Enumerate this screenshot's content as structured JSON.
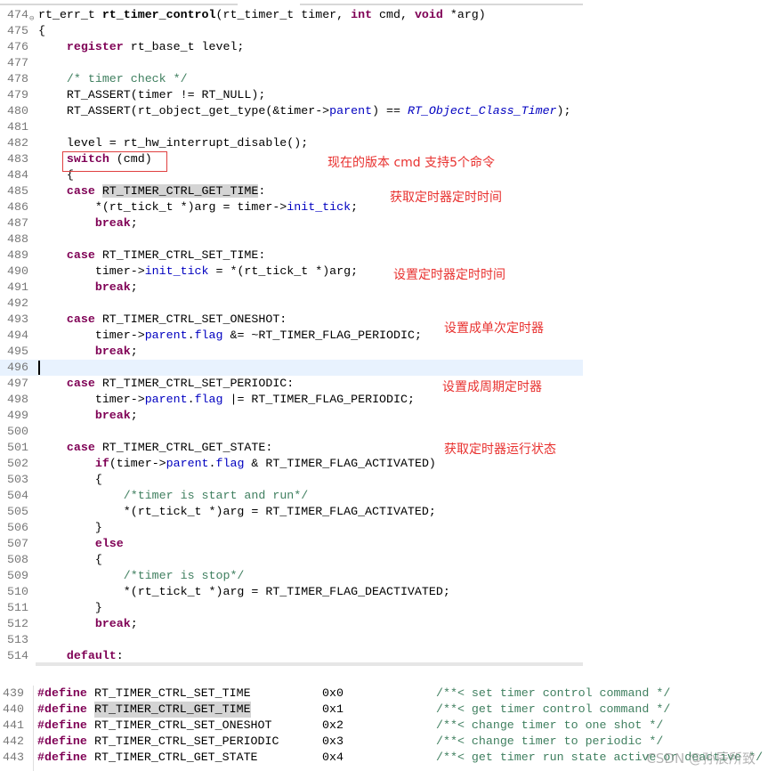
{
  "top_editor": {
    "lines": [
      {
        "n": "474",
        "t": [
          [
            "p",
            "rt_err_t "
          ],
          [
            "b",
            "rt_timer_control"
          ],
          [
            "p",
            "(rt_timer_t timer, "
          ],
          [
            "k",
            "int"
          ],
          [
            "p",
            " cmd, "
          ],
          [
            "k",
            "void"
          ],
          [
            "p",
            " *arg)"
          ]
        ]
      },
      {
        "n": "475",
        "t": [
          [
            "p",
            "{"
          ]
        ]
      },
      {
        "n": "476",
        "t": [
          [
            "p",
            "    "
          ],
          [
            "k",
            "register"
          ],
          [
            "p",
            " rt_base_t level;"
          ]
        ]
      },
      {
        "n": "477",
        "t": []
      },
      {
        "n": "478",
        "t": [
          [
            "p",
            "    "
          ],
          [
            "c",
            "/* timer check */"
          ]
        ]
      },
      {
        "n": "479",
        "t": [
          [
            "p",
            "    RT_ASSERT(timer != RT_NULL);"
          ]
        ]
      },
      {
        "n": "480",
        "t": [
          [
            "p",
            "    RT_ASSERT(rt_object_get_type(&timer->"
          ],
          [
            "f",
            "parent"
          ],
          [
            "p",
            ") == "
          ],
          [
            "e",
            "RT_Object_Class_Timer"
          ],
          [
            "p",
            ");"
          ]
        ]
      },
      {
        "n": "481",
        "t": []
      },
      {
        "n": "482",
        "t": [
          [
            "p",
            "    level = rt_hw_interrupt_disable();"
          ]
        ]
      },
      {
        "n": "483",
        "t": [
          [
            "p",
            "    "
          ],
          [
            "k",
            "switch"
          ],
          [
            "p",
            " (cmd)"
          ]
        ]
      },
      {
        "n": "484",
        "t": [
          [
            "p",
            "    {"
          ]
        ]
      },
      {
        "n": "485",
        "t": [
          [
            "p",
            "    "
          ],
          [
            "k",
            "case"
          ],
          [
            "p",
            " "
          ],
          [
            "h",
            "RT_TIMER_CTRL_GET_TIME"
          ],
          [
            "p",
            ":"
          ]
        ]
      },
      {
        "n": "486",
        "t": [
          [
            "p",
            "        *(rt_tick_t *)arg = timer->"
          ],
          [
            "f",
            "init_tick"
          ],
          [
            "p",
            ";"
          ]
        ]
      },
      {
        "n": "487",
        "t": [
          [
            "p",
            "        "
          ],
          [
            "k",
            "break"
          ],
          [
            "p",
            ";"
          ]
        ]
      },
      {
        "n": "488",
        "t": []
      },
      {
        "n": "489",
        "t": [
          [
            "p",
            "    "
          ],
          [
            "k",
            "case"
          ],
          [
            "p",
            " RT_TIMER_CTRL_SET_TIME:"
          ]
        ]
      },
      {
        "n": "490",
        "t": [
          [
            "p",
            "        timer->"
          ],
          [
            "f",
            "init_tick"
          ],
          [
            "p",
            " = *(rt_tick_t *)arg;"
          ]
        ]
      },
      {
        "n": "491",
        "t": [
          [
            "p",
            "        "
          ],
          [
            "k",
            "break"
          ],
          [
            "p",
            ";"
          ]
        ]
      },
      {
        "n": "492",
        "t": []
      },
      {
        "n": "493",
        "t": [
          [
            "p",
            "    "
          ],
          [
            "k",
            "case"
          ],
          [
            "p",
            " RT_TIMER_CTRL_SET_ONESHOT:"
          ]
        ]
      },
      {
        "n": "494",
        "t": [
          [
            "p",
            "        timer->"
          ],
          [
            "f",
            "parent"
          ],
          [
            "p",
            "."
          ],
          [
            "f",
            "flag"
          ],
          [
            "p",
            " &= ~RT_TIMER_FLAG_PERIODIC;"
          ]
        ]
      },
      {
        "n": "495",
        "t": [
          [
            "p",
            "        "
          ],
          [
            "k",
            "break"
          ],
          [
            "p",
            ";"
          ]
        ]
      },
      {
        "n": "496",
        "t": [],
        "current": true
      },
      {
        "n": "497",
        "t": [
          [
            "p",
            "    "
          ],
          [
            "k",
            "case"
          ],
          [
            "p",
            " RT_TIMER_CTRL_SET_PERIODIC:"
          ]
        ]
      },
      {
        "n": "498",
        "t": [
          [
            "p",
            "        timer->"
          ],
          [
            "f",
            "parent"
          ],
          [
            "p",
            "."
          ],
          [
            "f",
            "flag"
          ],
          [
            "p",
            " |= RT_TIMER_FLAG_PERIODIC;"
          ]
        ]
      },
      {
        "n": "499",
        "t": [
          [
            "p",
            "        "
          ],
          [
            "k",
            "break"
          ],
          [
            "p",
            ";"
          ]
        ]
      },
      {
        "n": "500",
        "t": []
      },
      {
        "n": "501",
        "t": [
          [
            "p",
            "    "
          ],
          [
            "k",
            "case"
          ],
          [
            "p",
            " RT_TIMER_CTRL_GET_STATE:"
          ]
        ]
      },
      {
        "n": "502",
        "t": [
          [
            "p",
            "        "
          ],
          [
            "k",
            "if"
          ],
          [
            "p",
            "(timer->"
          ],
          [
            "f",
            "parent"
          ],
          [
            "p",
            "."
          ],
          [
            "f",
            "flag"
          ],
          [
            "p",
            " & RT_TIMER_FLAG_ACTIVATED)"
          ]
        ]
      },
      {
        "n": "503",
        "t": [
          [
            "p",
            "        {"
          ]
        ]
      },
      {
        "n": "504",
        "t": [
          [
            "p",
            "            "
          ],
          [
            "c",
            "/*timer is start and run*/"
          ]
        ]
      },
      {
        "n": "505",
        "t": [
          [
            "p",
            "            *(rt_tick_t *)arg = RT_TIMER_FLAG_ACTIVATED;"
          ]
        ]
      },
      {
        "n": "506",
        "t": [
          [
            "p",
            "        }"
          ]
        ]
      },
      {
        "n": "507",
        "t": [
          [
            "p",
            "        "
          ],
          [
            "k",
            "else"
          ]
        ]
      },
      {
        "n": "508",
        "t": [
          [
            "p",
            "        {"
          ]
        ]
      },
      {
        "n": "509",
        "t": [
          [
            "p",
            "            "
          ],
          [
            "c",
            "/*timer is stop*/"
          ]
        ]
      },
      {
        "n": "510",
        "t": [
          [
            "p",
            "            *(rt_tick_t *)arg = RT_TIMER_FLAG_DEACTIVATED;"
          ]
        ]
      },
      {
        "n": "511",
        "t": [
          [
            "p",
            "        }"
          ]
        ]
      },
      {
        "n": "512",
        "t": [
          [
            "p",
            "        "
          ],
          [
            "k",
            "break"
          ],
          [
            "p",
            ";"
          ]
        ]
      },
      {
        "n": "513",
        "t": []
      },
      {
        "n": "514",
        "t": [
          [
            "p",
            "    "
          ],
          [
            "k",
            "default"
          ],
          [
            "p",
            ":"
          ]
        ]
      }
    ]
  },
  "annotations": {
    "cmd_count": "现在的版本 cmd 支持5个命令",
    "get_time": "获取定时器定时时间",
    "set_time": "设置定时器定时时间",
    "set_oneshot": "设置成单次定时器",
    "set_periodic": "设置成周期定时器",
    "get_state": "获取定时器运行状态"
  },
  "defines": {
    "rows": [
      {
        "n": "439",
        "kw": "#define",
        "name": "RT_TIMER_CTRL_SET_TIME",
        "value": "0x0",
        "comment": "/**< set timer control command */",
        "highlight": false
      },
      {
        "n": "440",
        "kw": "#define",
        "name": "RT_TIMER_CTRL_GET_TIME",
        "value": "0x1",
        "comment": "/**< get timer control command */",
        "highlight": true
      },
      {
        "n": "441",
        "kw": "#define",
        "name": "RT_TIMER_CTRL_SET_ONESHOT",
        "value": "0x2",
        "comment": "/**< change timer to one shot */",
        "highlight": false
      },
      {
        "n": "442",
        "kw": "#define",
        "name": "RT_TIMER_CTRL_SET_PERIODIC",
        "value": "0x3",
        "comment": "/**< change timer to periodic */",
        "highlight": false
      },
      {
        "n": "443",
        "kw": "#define",
        "name": "RT_TIMER_CTRL_GET_STATE",
        "value": "0x4",
        "comment": "/**< get timer run state active or deactive */",
        "highlight": false
      }
    ]
  },
  "watermark": "CSDN @孙辰所致",
  "colors": {
    "keyword": "#7f0055",
    "comment": "#3f7f5f",
    "field": "#0000c0",
    "annotation": "#e8312f",
    "current_line": "#e8f2fe"
  }
}
